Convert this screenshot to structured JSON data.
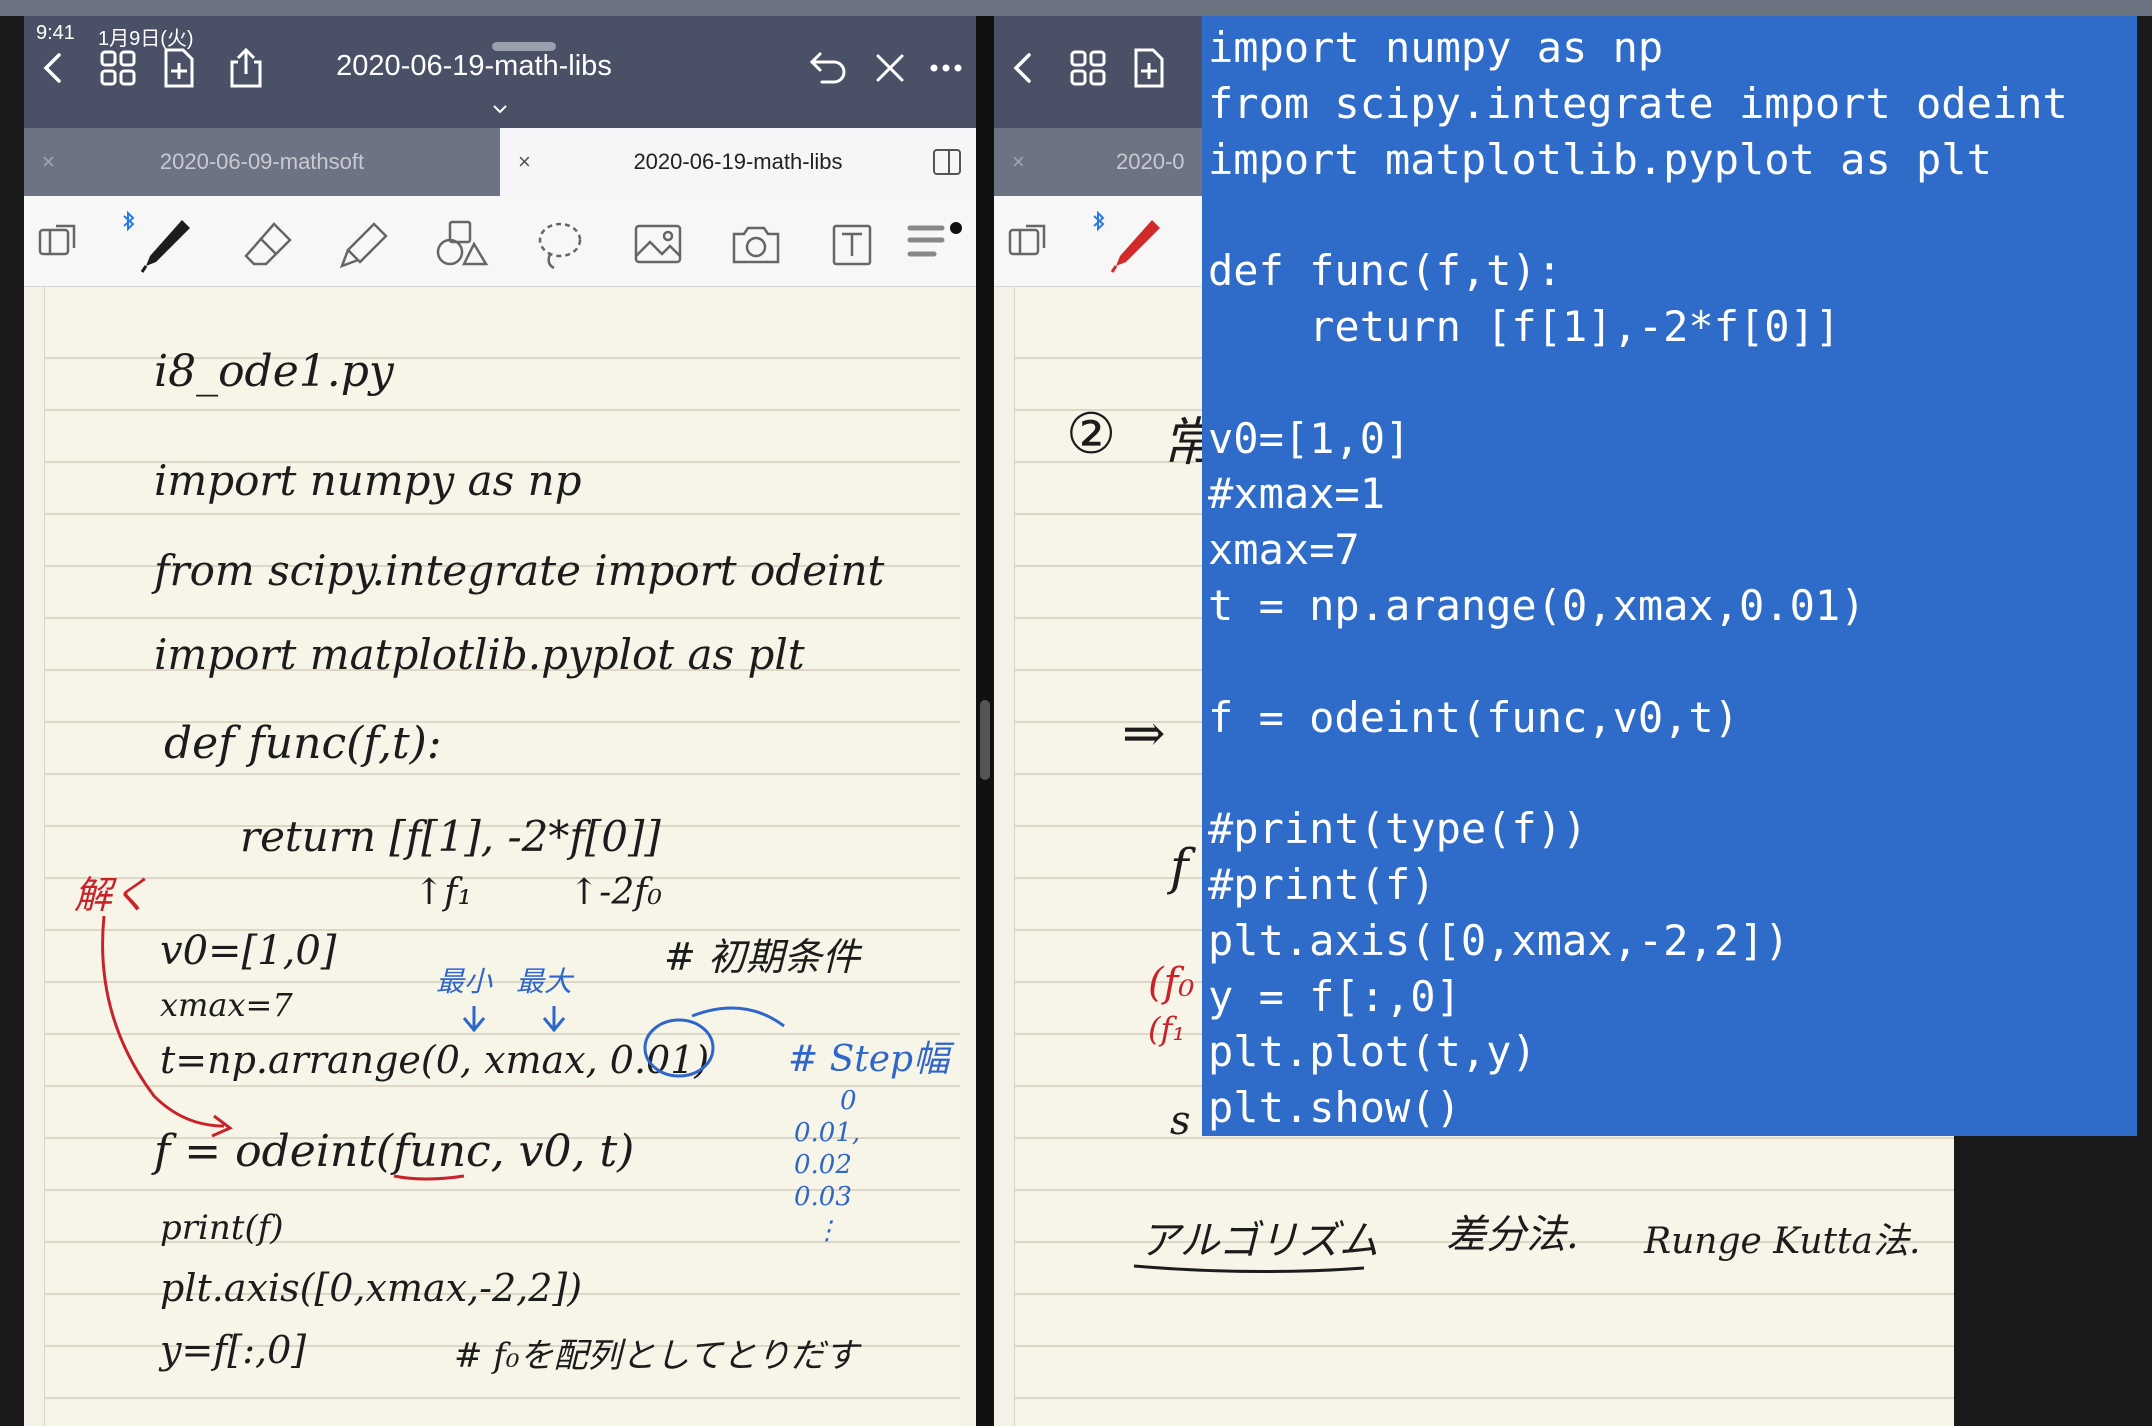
{
  "status_bar": {
    "time": "9:41",
    "date": "1月9日(火)"
  },
  "left_pane": {
    "nav_title": "2020-06-19-math-libs",
    "tabs": [
      {
        "label": "2020-06-09-mathsoft",
        "active": false
      },
      {
        "label": "2020-06-19-math-libs",
        "active": true
      }
    ],
    "notes": [
      "i8_ode1.py",
      "import numpy as np",
      "from scipy.integrate import odeint",
      "import matplotlib.pyplot as plt",
      "def func(f,t):",
      "return [f[1], -2*f[0]]",
      "↑f₁",
      "↑-2f₀",
      "解く",
      "v0=[1,0]",
      "# 初期条件",
      "最小",
      "最大",
      "xmax=7",
      "t=np.arrange(0, xmax, 0.01)",
      "# Step幅",
      "0",
      "0.01,",
      "0.02",
      "0.03",
      "⋮",
      "f = odeint(func, v0, t)",
      "print(f)",
      "plt.axis([0,xmax,-2,2])",
      "y=f[:,0]",
      "# f₀を配列としてとりだす"
    ]
  },
  "right_pane": {
    "tab_partial": "2020-0",
    "notes": [
      "②",
      "常",
      "⇒",
      "f",
      "(f₀",
      "(f₁",
      "s",
      "アルゴリズム",
      "差分法.",
      "Runge Kutta法."
    ]
  },
  "code_overlay": {
    "lines": [
      "import numpy as np",
      "from scipy.integrate import odeint",
      "import matplotlib.pyplot as plt",
      "",
      "def func(f,t):",
      "    return [f[1],-2*f[0]]",
      "",
      "v0=[1,0]",
      "#xmax=1",
      "xmax=7",
      "t = np.arange(0,xmax,0.01)",
      "",
      "f = odeint(func,v0,t)",
      "",
      "#print(type(f))",
      "#print(f)",
      "plt.axis([0,xmax,-2,2])",
      "y = f[:,0]",
      "plt.plot(t,y)",
      "plt.show()"
    ]
  },
  "colors": {
    "nav": "#4a5166",
    "code_bg": "#2f6bc9",
    "ink_red": "#c8222a",
    "ink_blue": "#2f66c9"
  },
  "icons": [
    "back-chevron-icon",
    "grid-icon",
    "add-page-icon",
    "share-icon",
    "undo-icon",
    "close-x-icon",
    "more-icon",
    "sidebar-toggle-icon",
    "read-mode-icon",
    "bluetooth-icon",
    "pen-icon",
    "eraser-icon",
    "highlighter-icon",
    "shapes-icon",
    "lasso-icon",
    "image-icon",
    "camera-icon",
    "text-tool-icon",
    "pen-settings-icon"
  ]
}
